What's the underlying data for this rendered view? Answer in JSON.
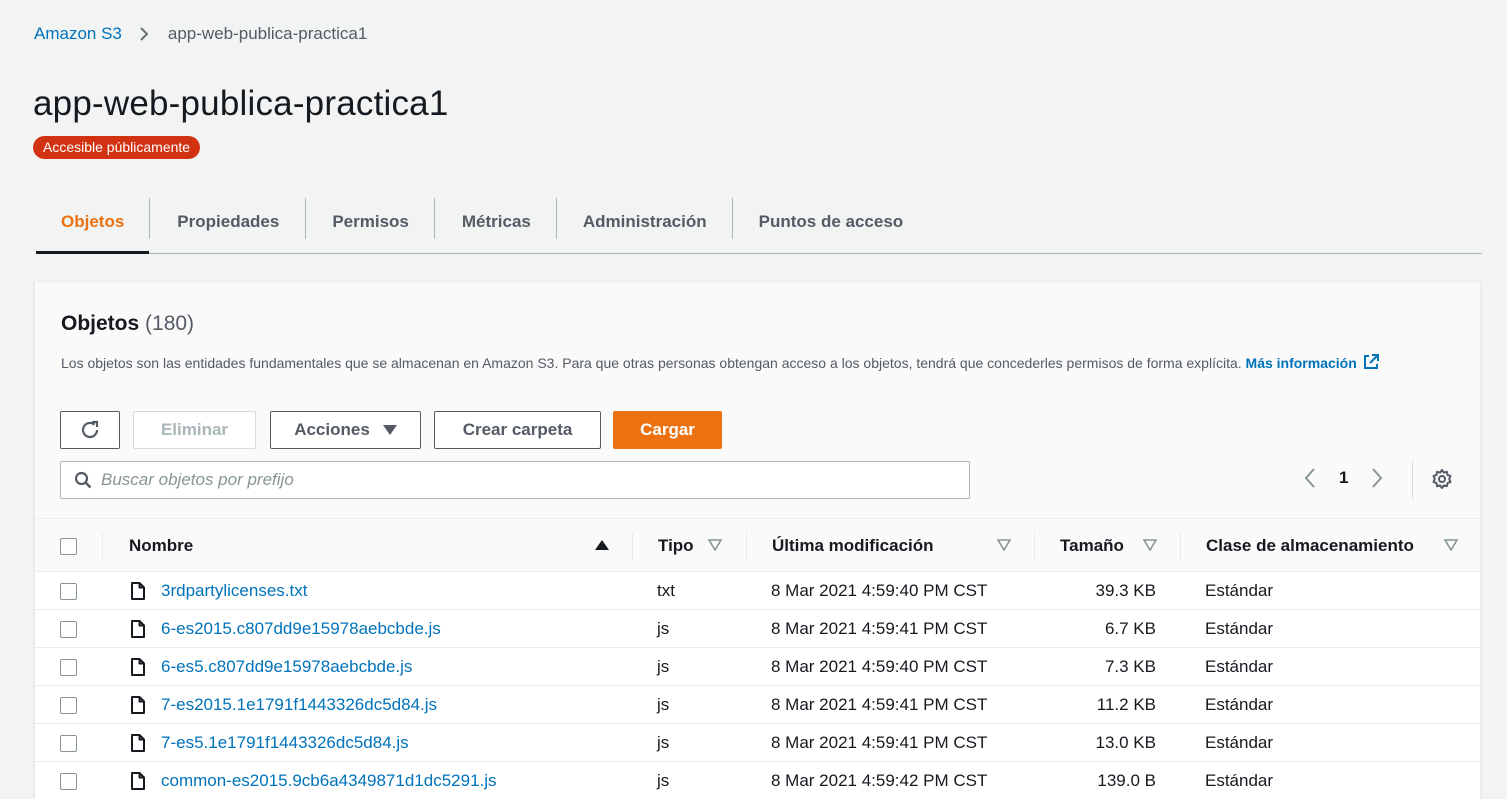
{
  "breadcrumb": {
    "root": "Amazon S3",
    "current": "app-web-publica-practica1"
  },
  "page": {
    "title": "app-web-publica-practica1",
    "badge": "Accesible públicamente"
  },
  "tabs": [
    {
      "label": "Objetos",
      "active": true
    },
    {
      "label": "Propiedades",
      "active": false
    },
    {
      "label": "Permisos",
      "active": false
    },
    {
      "label": "Métricas",
      "active": false
    },
    {
      "label": "Administración",
      "active": false
    },
    {
      "label": "Puntos de acceso",
      "active": false
    }
  ],
  "objects_panel": {
    "title": "Objetos",
    "count": "(180)",
    "description": "Los objetos son las entidades fundamentales que se almacenan en Amazon S3. Para que otras personas obtengan acceso a los objetos, tendrá que concederles permisos de forma explícita.",
    "more_info": "Más información",
    "buttons": {
      "eliminar": "Eliminar",
      "acciones": "Acciones",
      "crear_carpeta": "Crear carpeta",
      "cargar": "Cargar"
    },
    "search": {
      "placeholder": "Buscar objetos por prefijo",
      "value": ""
    },
    "pagination": {
      "current_page": "1"
    },
    "columns": {
      "nombre": "Nombre",
      "tipo": "Tipo",
      "ultima_modificacion": "Última modificación",
      "tamano": "Tamaño",
      "clase": "Clase de almacenamiento"
    },
    "rows": [
      {
        "name": "3rdpartylicenses.txt",
        "type": "txt",
        "modified": "8 Mar 2021 4:59:40 PM CST",
        "size": "39.3 KB",
        "class": "Estándar"
      },
      {
        "name": "6-es2015.c807dd9e15978aebcbde.js",
        "type": "js",
        "modified": "8 Mar 2021 4:59:41 PM CST",
        "size": "6.7 KB",
        "class": "Estándar"
      },
      {
        "name": "6-es5.c807dd9e15978aebcbde.js",
        "type": "js",
        "modified": "8 Mar 2021 4:59:40 PM CST",
        "size": "7.3 KB",
        "class": "Estándar"
      },
      {
        "name": "7-es2015.1e1791f1443326dc5d84.js",
        "type": "js",
        "modified": "8 Mar 2021 4:59:41 PM CST",
        "size": "11.2 KB",
        "class": "Estándar"
      },
      {
        "name": "7-es5.1e1791f1443326dc5d84.js",
        "type": "js",
        "modified": "8 Mar 2021 4:59:41 PM CST",
        "size": "13.0 KB",
        "class": "Estándar"
      },
      {
        "name": "common-es2015.9cb6a4349871d1dc5291.js",
        "type": "js",
        "modified": "8 Mar 2021 4:59:42 PM CST",
        "size": "139.0 B",
        "class": "Estándar"
      }
    ]
  },
  "colors": {
    "accent": "#ec7211",
    "link": "#0073bb",
    "badge": "#d13212"
  }
}
